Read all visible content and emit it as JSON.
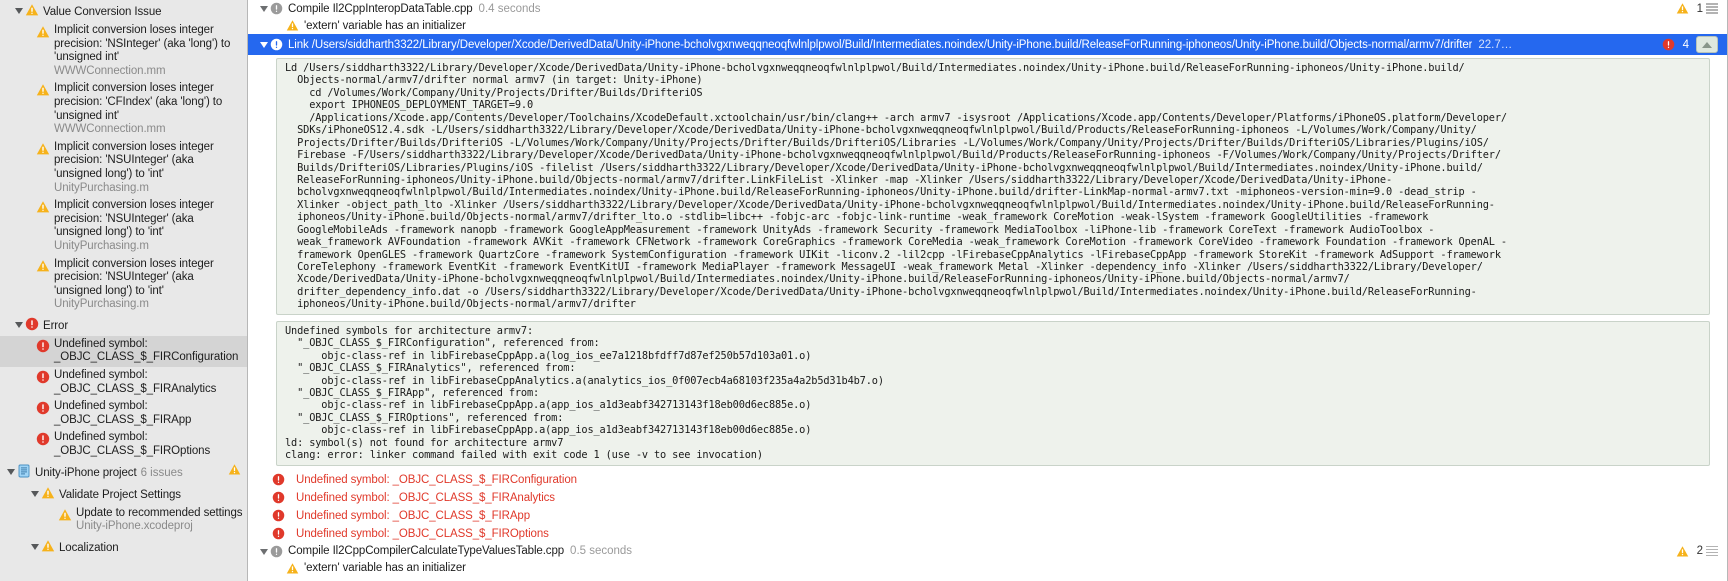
{
  "sidebar": {
    "groups": [
      {
        "name": "Value Conversion Issue",
        "icon": "warning-icon",
        "items": [
          {
            "title": "Implicit conversion loses integer precision: 'NSInteger' (aka 'long') to 'unsigned int'",
            "file": "WWWConnection.mm",
            "icon": "warning-icon"
          },
          {
            "title": "Implicit conversion loses integer precision: 'CFIndex' (aka 'long') to 'unsigned int'",
            "file": "WWWConnection.mm",
            "icon": "warning-icon"
          },
          {
            "title": "Implicit conversion loses integer precision: 'NSUInteger' (aka 'unsigned long') to 'int'",
            "file": "UnityPurchasing.m",
            "icon": "warning-icon"
          },
          {
            "title": "Implicit conversion loses integer precision: 'NSUInteger' (aka 'unsigned long') to 'int'",
            "file": "UnityPurchasing.m",
            "icon": "warning-icon"
          },
          {
            "title": "Implicit conversion loses integer precision: 'NSUInteger' (aka 'unsigned long') to 'int'",
            "file": "UnityPurchasing.m",
            "icon": "warning-icon"
          }
        ]
      },
      {
        "name": "Error",
        "icon": "error-icon",
        "items": [
          {
            "title": "Undefined symbol: _OBJC_CLASS_$_FIRConfiguration",
            "file": "",
            "icon": "error-icon",
            "selected": true
          },
          {
            "title": "Undefined symbol: _OBJC_CLASS_$_FIRAnalytics",
            "file": "",
            "icon": "error-icon"
          },
          {
            "title": "Undefined symbol: _OBJC_CLASS_$_FIRApp",
            "file": "",
            "icon": "error-icon"
          },
          {
            "title": "Undefined symbol: _OBJC_CLASS_$_FIROptions",
            "file": "",
            "icon": "error-icon"
          }
        ]
      }
    ],
    "project": {
      "name": "Unity-iPhone project",
      "issues": "6 issues",
      "icon": "project-document-icon",
      "badge": "warning-icon",
      "children": [
        {
          "name": "Validate Project Settings",
          "icon": "warning-icon",
          "items": [
            {
              "title": "Update to recommended settings",
              "file": "Unity-iPhone.xcodeproj",
              "icon": "warning-icon"
            }
          ]
        },
        {
          "name": "Localization",
          "icon": "warning-icon",
          "items": []
        }
      ]
    }
  },
  "log": {
    "rows": {
      "compile_top": {
        "label": "Compile Il2CppInteropDataTable.cpp",
        "time": "0.4 seconds",
        "warn_count": "1",
        "icon": "build-step-icon"
      },
      "warn_top": {
        "label": "'extern' variable has an initializer",
        "icon": "warning-icon"
      },
      "link_selected": {
        "label": "Link /Users/siddharth3322/Library/Developer/Xcode/DerivedData/Unity-iPhone-bcholvgxnweqqneoqfwlnlplpwol/Build/Intermediates.noindex/Unity-iPhone.build/ReleaseForRunning-iphoneos/Unity-iPhone.build/Objects-normal/armv7/drifter",
        "time": "22.7…",
        "error_count": "4",
        "icon": "build-step-icon"
      },
      "compile_bottom": {
        "label": "Compile Il2CppCompilerCalculateTypeValuesTable.cpp",
        "time": "0.5 seconds",
        "warn_count": "2",
        "icon": "build-step-icon"
      },
      "warn_bottom": {
        "label": "'extern' variable has an initializer",
        "icon": "warning-icon"
      }
    },
    "command_block": "Ld /Users/siddharth3322/Library/Developer/Xcode/DerivedData/Unity-iPhone-bcholvgxnweqqneoqfwlnlplpwol/Build/Intermediates.noindex/Unity-iPhone.build/ReleaseForRunning-iphoneos/Unity-iPhone.build/\n  Objects-normal/armv7/drifter normal armv7 (in target: Unity-iPhone)\n    cd /Volumes/Work/Company/Unity/Projects/Drifter/Builds/DrifteriOS\n    export IPHONEOS_DEPLOYMENT_TARGET=9.0\n    /Applications/Xcode.app/Contents/Developer/Toolchains/XcodeDefault.xctoolchain/usr/bin/clang++ -arch armv7 -isysroot /Applications/Xcode.app/Contents/Developer/Platforms/iPhoneOS.platform/Developer/\n  SDKs/iPhoneOS12.4.sdk -L/Users/siddharth3322/Library/Developer/Xcode/DerivedData/Unity-iPhone-bcholvgxnweqqneoqfwlnlplpwol/Build/Products/ReleaseForRunning-iphoneos -L/Volumes/Work/Company/Unity/\n  Projects/Drifter/Builds/DrifteriOS -L/Volumes/Work/Company/Unity/Projects/Drifter/Builds/DrifteriOS/Libraries -L/Volumes/Work/Company/Unity/Projects/Drifter/Builds/DrifteriOS/Libraries/Plugins/iOS/\n  Firebase -F/Users/siddharth3322/Library/Developer/Xcode/DerivedData/Unity-iPhone-bcholvgxnweqqneoqfwlnlplpwol/Build/Products/ReleaseForRunning-iphoneos -F/Volumes/Work/Company/Unity/Projects/Drifter/\n  Builds/DrifteriOS/Libraries/Plugins/iOS -filelist /Users/siddharth3322/Library/Developer/Xcode/DerivedData/Unity-iPhone-bcholvgxnweqqneoqfwlnlplpwol/Build/Intermediates.noindex/Unity-iPhone.build/\n  ReleaseForRunning-iphoneos/Unity-iPhone.build/Objects-normal/armv7/drifter.LinkFileList -Xlinker -map -Xlinker /Users/siddharth3322/Library/Developer/Xcode/DerivedData/Unity-iPhone-\n  bcholvgxnweqqneoqfwlnlplpwol/Build/Intermediates.noindex/Unity-iPhone.build/ReleaseForRunning-iphoneos/Unity-iPhone.build/drifter-LinkMap-normal-armv7.txt -miphoneos-version-min=9.0 -dead_strip -\n  Xlinker -object_path_lto -Xlinker /Users/siddharth3322/Library/Developer/Xcode/DerivedData/Unity-iPhone-bcholvgxnweqqneoqfwlnlplpwol/Build/Intermediates.noindex/Unity-iPhone.build/ReleaseForRunning-\n  iphoneos/Unity-iPhone.build/Objects-normal/armv7/drifter_lto.o -stdlib=libc++ -fobjc-arc -fobjc-link-runtime -weak_framework CoreMotion -weak-lSystem -framework GoogleUtilities -framework\n  GoogleMobileAds -framework nanopb -framework GoogleAppMeasurement -framework UnityAds -framework Security -framework MediaToolbox -liPhone-lib -framework CoreText -framework AudioToolbox -\n  weak_framework AVFoundation -framework AVKit -framework CFNetwork -framework CoreGraphics -framework CoreMedia -weak_framework CoreMotion -framework CoreVideo -framework Foundation -framework OpenAL -\n  framework OpenGLES -framework QuartzCore -framework SystemConfiguration -framework UIKit -liconv.2 -lil2cpp -lFirebaseCppAnalytics -lFirebaseCppApp -framework StoreKit -framework AdSupport -framework\n  CoreTelephony -framework EventKit -framework EventKitUI -framework MediaPlayer -framework MessageUI -weak_framework Metal -Xlinker -dependency_info -Xlinker /Users/siddharth3322/Library/Developer/\n  Xcode/DerivedData/Unity-iPhone-bcholvgxnweqqneoqfwlnlplpwol/Build/Intermediates.noindex/Unity-iPhone.build/ReleaseForRunning-iphoneos/Unity-iPhone.build/Objects-normal/armv7/\n  drifter_dependency_info.dat -o /Users/siddharth3322/Library/Developer/Xcode/DerivedData/Unity-iPhone-bcholvgxnweqqneoqfwlnlplpwol/Build/Intermediates.noindex/Unity-iPhone.build/ReleaseForRunning-\n  iphoneos/Unity-iPhone.build/Objects-normal/armv7/drifter",
    "output_block": "Undefined symbols for architecture armv7:\n  \"_OBJC_CLASS_$_FIRConfiguration\", referenced from:\n      objc-class-ref in libFirebaseCppApp.a(log_ios_ee7a1218bfdff7d87ef250b57d103a01.o)\n  \"_OBJC_CLASS_$_FIRAnalytics\", referenced from:\n      objc-class-ref in libFirebaseCppAnalytics.a(analytics_ios_0f007ecb4a68103f235a4a2b5d31b4b7.o)\n  \"_OBJC_CLASS_$_FIRApp\", referenced from:\n      objc-class-ref in libFirebaseCppApp.a(app_ios_a1d3eabf342713143f18eb00d6ec885e.o)\n  \"_OBJC_CLASS_$_FIROptions\", referenced from:\n      objc-class-ref in libFirebaseCppApp.a(app_ios_a1d3eabf342713143f18eb00d6ec885e.o)\nld: symbol(s) not found for architecture armv7\nclang: error: linker command failed with exit code 1 (use -v to see invocation)",
    "errors": [
      {
        "text": "Undefined symbol: _OBJC_CLASS_$_FIRConfiguration",
        "icon": "error-icon"
      },
      {
        "text": "Undefined symbol: _OBJC_CLASS_$_FIRAnalytics",
        "icon": "error-icon"
      },
      {
        "text": "Undefined symbol: _OBJC_CLASS_$_FIRApp",
        "icon": "error-icon"
      },
      {
        "text": "Undefined symbol: _OBJC_CLASS_$_FIROptions",
        "icon": "error-icon"
      }
    ]
  },
  "colors": {
    "selection_blue": "#2568ef",
    "error_red": "#e0392b",
    "warning_yellow": "#f6b21b",
    "sidebar_bg": "#e8e8e8",
    "code_bg": "#eef2ec"
  }
}
